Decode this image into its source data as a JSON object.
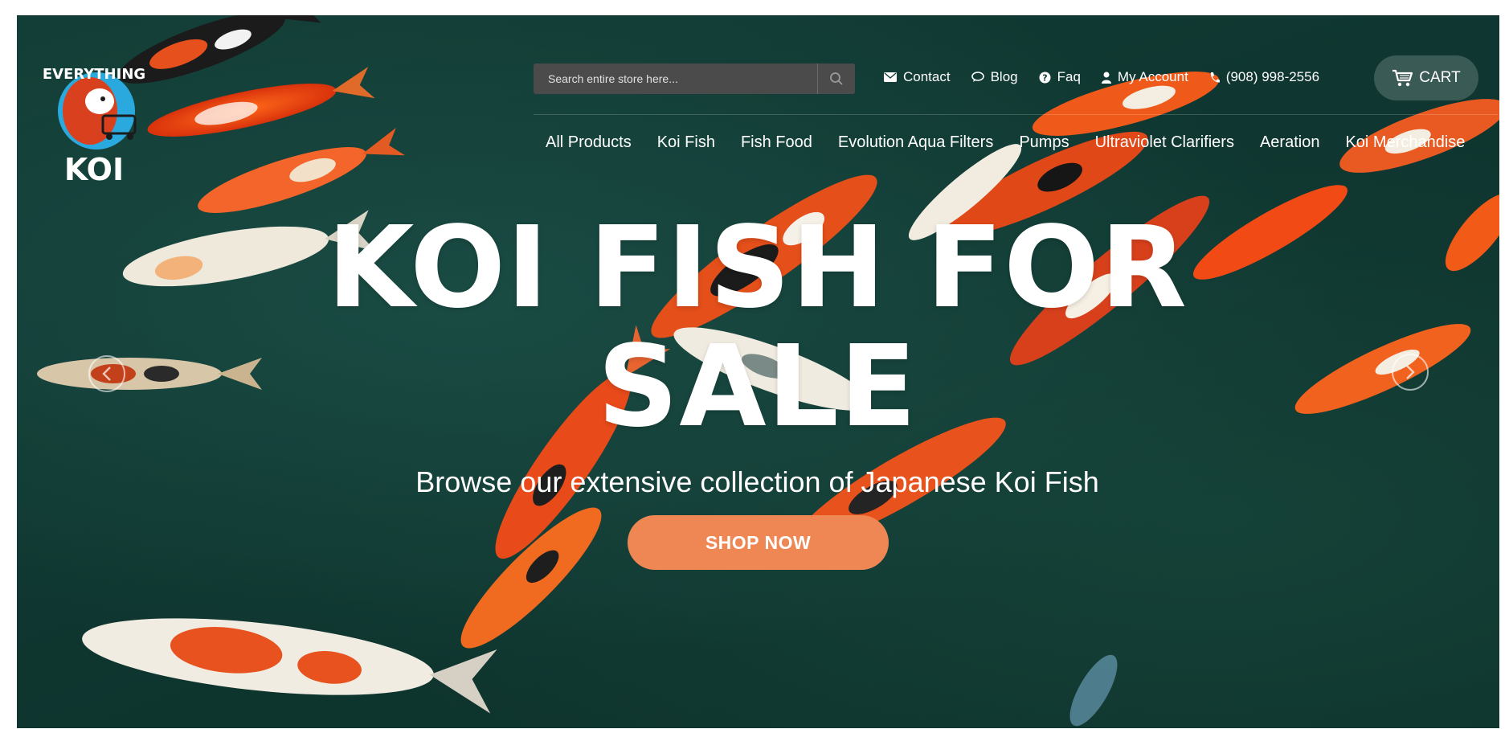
{
  "brand": {
    "logo_top_text": "EVERYTHING",
    "logo_bottom_text": "KOI"
  },
  "search": {
    "placeholder": "Search entire store here..."
  },
  "top_links": [
    {
      "label": "Contact",
      "icon": "envelope-icon"
    },
    {
      "label": "Blog",
      "icon": "speech-bubble-icon"
    },
    {
      "label": "Faq",
      "icon": "question-circle-icon"
    },
    {
      "label": "My Account",
      "icon": "user-icon"
    },
    {
      "label": "(908) 998-2556",
      "icon": "phone-icon"
    }
  ],
  "cart": {
    "label": "CART",
    "icon": "shopping-cart-icon"
  },
  "nav": [
    "All Products",
    "Koi Fish",
    "Fish Food",
    "Evolution Aqua Filters",
    "Pumps",
    "Ultraviolet Clarifiers",
    "Aeration",
    "Koi Merchandise"
  ],
  "hero": {
    "headline_line1": "KOI FISH FOR",
    "headline_line2": "SALE",
    "subheadline": "Browse our extensive collection of Japanese Koi Fish",
    "cta_label": "SHOP NOW"
  },
  "colors": {
    "background": "#0f3630",
    "cta": "#ee8753",
    "search_bg": "#4b4b4b"
  }
}
